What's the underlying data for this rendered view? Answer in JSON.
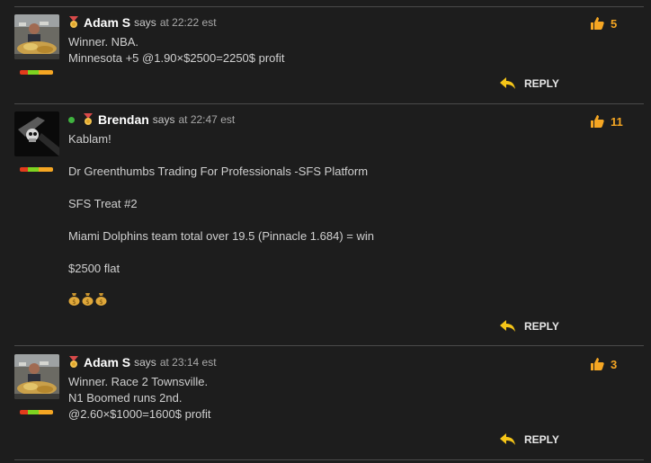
{
  "colors": {
    "background": "#1d1d1d",
    "accent": "#f5a623",
    "online": "#3fb33f"
  },
  "comments": [
    {
      "author": "Adam S",
      "says": "says",
      "time": "at 22:22 est",
      "online": false,
      "likes": "5",
      "reply_label": "REPLY",
      "lines": [
        "Winner. NBA.",
        "Minnesota +5 @1.90×$2500=2250$ profit"
      ]
    },
    {
      "author": "Brendan",
      "says": "says",
      "time": "at 22:47 est",
      "online": true,
      "likes": "11",
      "reply_label": "REPLY",
      "lines": [
        "Kablam!",
        "Dr Greenthumbs Trading For Professionals -SFS Platform",
        "SFS Treat #2",
        "Miami Dolphins team total over 19.5 (Pinnacle 1.684) = win",
        "$2500 flat"
      ],
      "emoji": "money-bag x3"
    },
    {
      "author": "Adam S",
      "says": "says",
      "time": "at 23:14 est",
      "online": false,
      "likes": "3",
      "reply_label": "REPLY",
      "lines": [
        "Winner. Race 2 Townsville.",
        "N1 Boomed runs 2nd.",
        "@2.60×$1000=1600$ profit"
      ]
    }
  ]
}
